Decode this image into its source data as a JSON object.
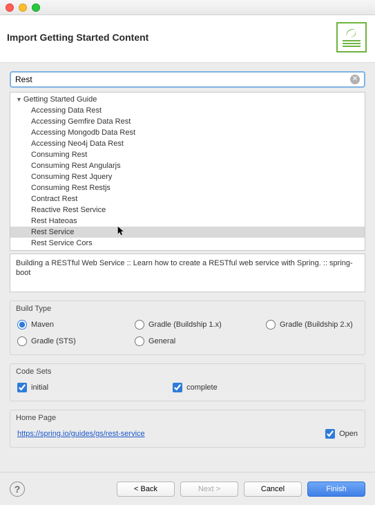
{
  "window": {
    "title": "Import Getting Started Content"
  },
  "search": {
    "value": "Rest"
  },
  "tree": {
    "root": "Getting Started Guide",
    "items": [
      "Accessing Data Rest",
      "Accessing Gemfire Data Rest",
      "Accessing Mongodb Data Rest",
      "Accessing Neo4j Data Rest",
      "Consuming Rest",
      "Consuming Rest Angularjs",
      "Consuming Rest Jquery",
      "Consuming Rest Restjs",
      "Contract Rest",
      "Reactive Rest Service",
      "Rest Hateoas",
      "Rest Service",
      "Rest Service Cors"
    ],
    "selected": "Rest Service"
  },
  "description": "Building a RESTful Web Service :: Learn how to create a RESTful web service with Spring. :: spring-boot",
  "buildType": {
    "label": "Build Type",
    "options": {
      "maven": "Maven",
      "gradle1": "Gradle (Buildship 1.x)",
      "gradle2": "Gradle (Buildship 2.x)",
      "gradleSts": "Gradle (STS)",
      "general": "General"
    },
    "selected": "maven"
  },
  "codeSets": {
    "label": "Code Sets",
    "initial": {
      "label": "initial",
      "checked": true
    },
    "complete": {
      "label": "complete",
      "checked": true
    }
  },
  "homePage": {
    "label": "Home Page",
    "url": "https://spring.io/guides/gs/rest-service",
    "openLabel": "Open",
    "openChecked": true
  },
  "footer": {
    "back": "< Back",
    "next": "Next >",
    "cancel": "Cancel",
    "finish": "Finish"
  }
}
